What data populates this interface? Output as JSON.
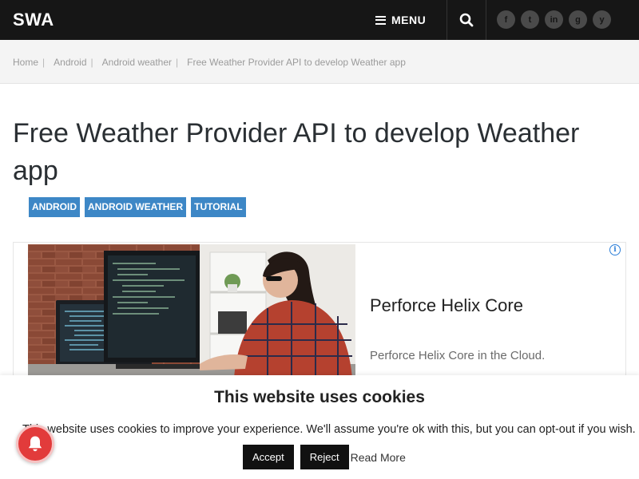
{
  "header": {
    "brand": "SWA",
    "menu_label": "MENU",
    "social_icons": [
      "facebook-icon",
      "twitter-icon",
      "linkedin-icon",
      "github-icon",
      "youtube-icon"
    ],
    "social_glyphs": [
      "f",
      "t",
      "in",
      "g",
      "y"
    ]
  },
  "breadcrumb": {
    "items": [
      "Home",
      "Android",
      "Android weather",
      "Free Weather Provider API to develop Weather app"
    ]
  },
  "article": {
    "title": "Free Weather Provider API to develop Weather app",
    "tags": [
      "ANDROID",
      "ANDROID WEATHER",
      "TUTORIAL"
    ]
  },
  "ad": {
    "headline": "Perforce Helix Core",
    "description": "Perforce Helix Core in the Cloud."
  },
  "cookie": {
    "title": "This website uses cookies",
    "text": "This website uses cookies to improve your experience. We'll assume you're ok with this, but you can opt-out if you wish.",
    "accept_label": "Accept",
    "reject_label": "Reject",
    "readmore_label": "Read More"
  },
  "colors": {
    "header_bg": "#161616",
    "tag_bg": "#3d87c6",
    "bell_bg": "#e23b3b"
  }
}
